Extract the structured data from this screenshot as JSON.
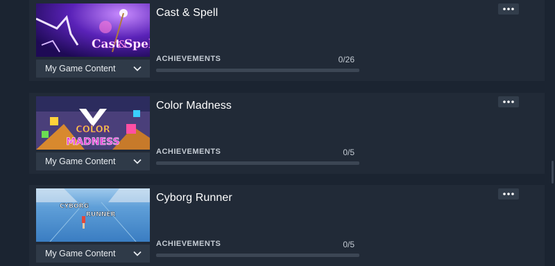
{
  "games": [
    {
      "title": "Cast & Spell",
      "content_filter": "My Game Content",
      "achievements_label": "ACHIEVEMENTS",
      "achievements_count": "0/26",
      "achievements_progress": 0,
      "thumbnail_text": [
        "Cast",
        "&",
        "Spell"
      ]
    },
    {
      "title": "Color Madness",
      "content_filter": "My Game Content",
      "achievements_label": "ACHIEVEMENTS",
      "achievements_count": "0/5",
      "achievements_progress": 0,
      "thumbnail_text": [
        "COLOR",
        "MADNESS"
      ]
    },
    {
      "title": "Cyborg Runner",
      "content_filter": "My Game Content",
      "achievements_label": "ACHIEVEMENTS",
      "achievements_count": "0/5",
      "achievements_progress": 0,
      "thumbnail_text": [
        "CYBORG",
        "RUNNER"
      ]
    }
  ],
  "colors": {
    "background": "#1b2431",
    "card": "#212a37",
    "progress_fill": "#4f8fd6"
  }
}
